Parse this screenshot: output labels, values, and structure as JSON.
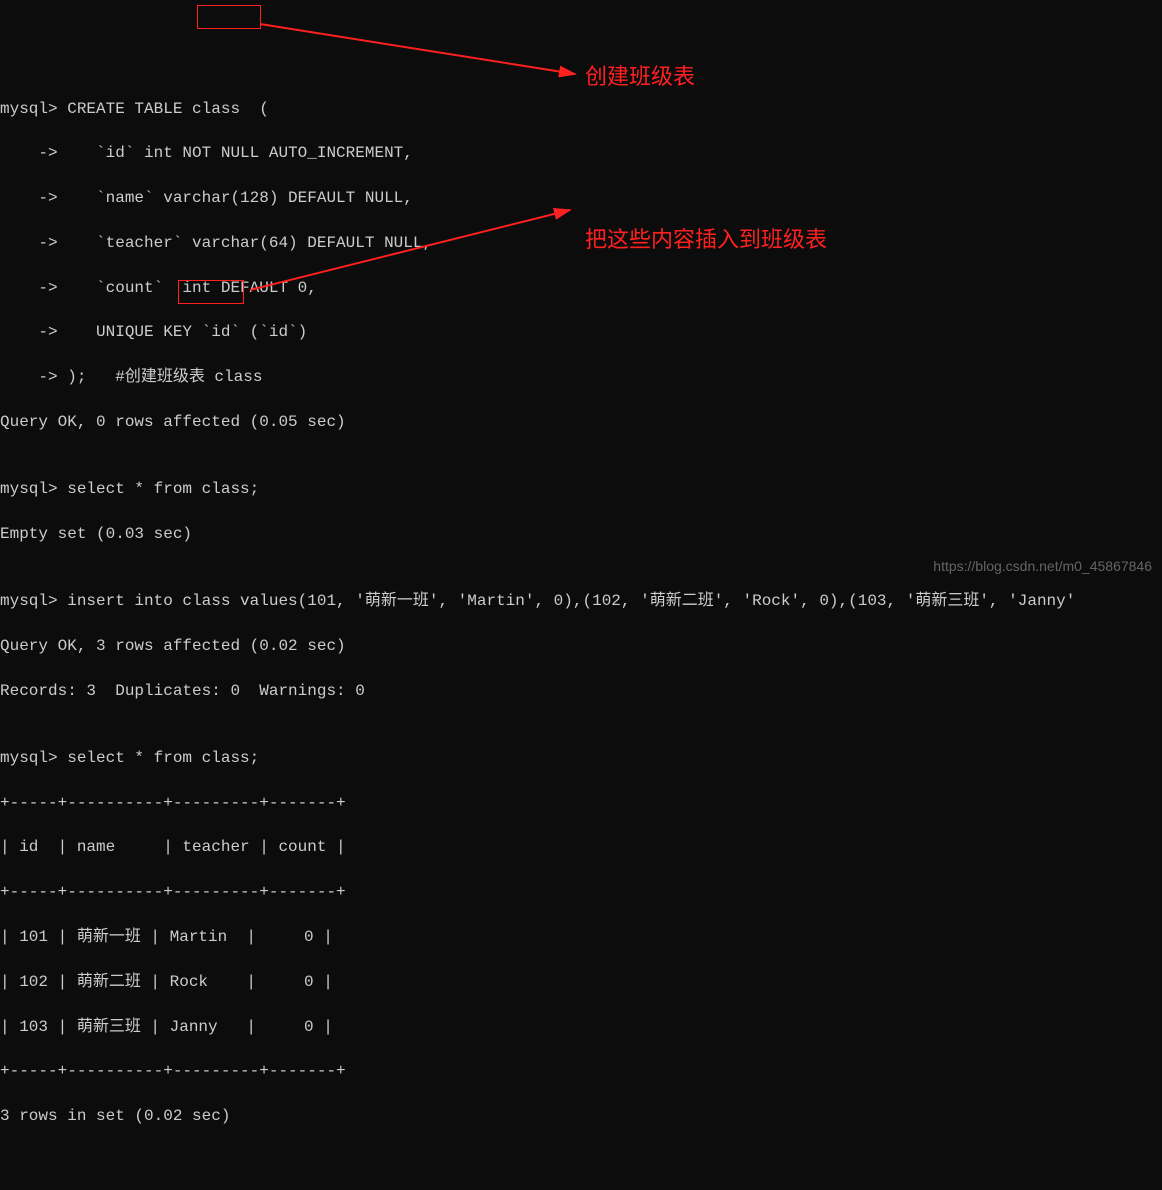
{
  "lines": {
    "l1": "mysql> CREATE TABLE class  (",
    "l2": "    ->    `id` int NOT NULL AUTO_INCREMENT,",
    "l3": "    ->    `name` varchar(128) DEFAULT NULL,",
    "l4": "    ->    `teacher` varchar(64) DEFAULT NULL,",
    "l5": "    ->    `count`  int DEFAULT 0,",
    "l6": "    ->    UNIQUE KEY `id` (`id`)",
    "l7": "    -> );   #创建班级表 class",
    "l8": "Query OK, 0 rows affected (0.05 sec)",
    "l9": "",
    "l10": "mysql> select * from class;",
    "l11": "Empty set (0.03 sec)",
    "l12": "",
    "l13": "mysql> insert into class values(101, '萌新一班', 'Martin', 0),(102, '萌新二班', 'Rock', 0),(103, '萌新三班', 'Janny'",
    "l14": "Query OK, 3 rows affected (0.02 sec)",
    "l15": "Records: 3  Duplicates: 0  Warnings: 0",
    "l16": "",
    "l17": "mysql> select * from class;",
    "l18": "+-----+----------+---------+-------+",
    "l19": "| id  | name     | teacher | count |",
    "l20": "+-----+----------+---------+-------+",
    "l21": "| 101 | 萌新一班 | Martin  |     0 |",
    "l22": "| 102 | 萌新二班 | Rock    |     0 |",
    "l23": "| 103 | 萌新三班 | Janny   |     0 |",
    "l24": "+-----+----------+---------+-------+",
    "l25": "3 rows in set (0.02 sec)"
  },
  "annotations": {
    "a1": "创建班级表",
    "a2": "把这些内容插入到班级表"
  },
  "watermark": "https://blog.csdn.net/m0_45867846",
  "chart_data": {
    "type": "table",
    "title": "class",
    "columns": [
      "id",
      "name",
      "teacher",
      "count"
    ],
    "rows": [
      {
        "id": 101,
        "name": "萌新一班",
        "teacher": "Martin",
        "count": 0
      },
      {
        "id": 102,
        "name": "萌新二班",
        "teacher": "Rock",
        "count": 0
      },
      {
        "id": 103,
        "name": "萌新三班",
        "teacher": "Janny",
        "count": 0
      }
    ]
  }
}
